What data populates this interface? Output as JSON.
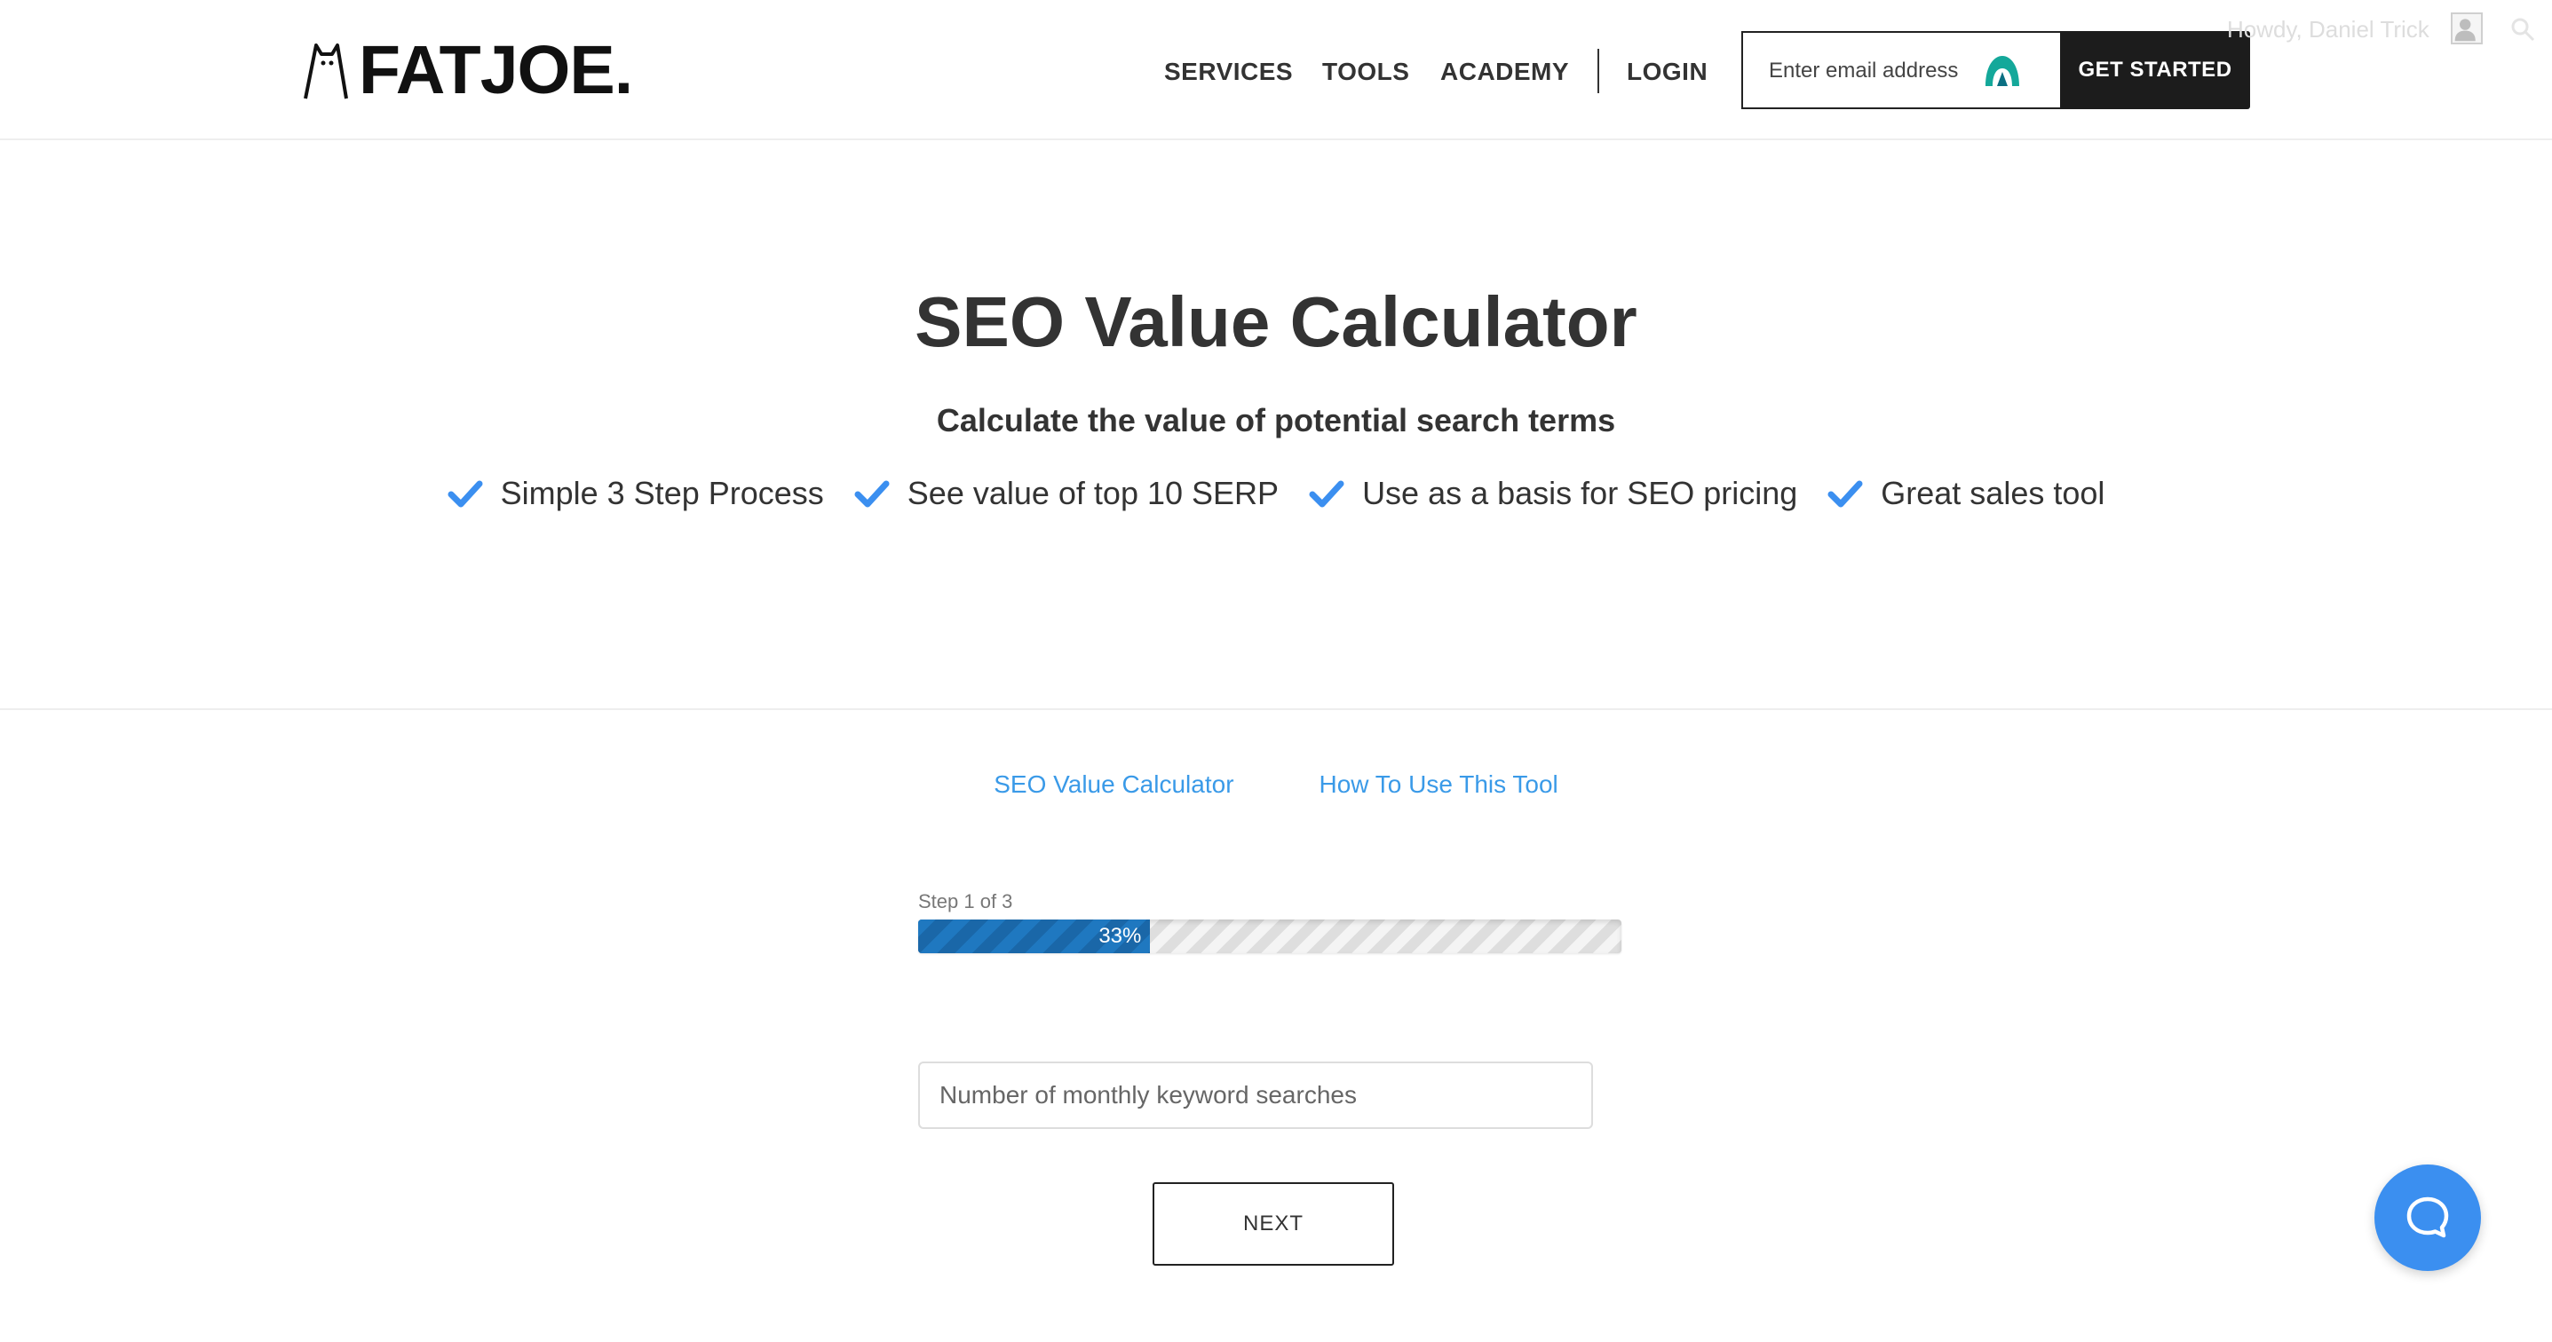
{
  "header": {
    "logo_text": "FATJOE.",
    "nav": [
      "SERVICES",
      "TOOLS",
      "ACADEMY"
    ],
    "login_label": "LOGIN",
    "email_placeholder": "Enter email address",
    "cta_label": "GET STARTED",
    "howdy_text": "Howdy, Daniel Trick"
  },
  "hero": {
    "title": "SEO Value Calculator",
    "subtitle": "Calculate the value of potential search terms",
    "features": [
      "Simple 3 Step Process",
      "See value of top 10 SERP",
      "Use as a basis for SEO pricing",
      "Great sales tool"
    ]
  },
  "tool": {
    "tabs": [
      "SEO Value Calculator",
      "How To Use This Tool"
    ],
    "step_label": "Step 1 of 3",
    "progress_percent": 33,
    "progress_label": "33%",
    "input_placeholder": "Number of monthly keyword searches",
    "next_label": "NEXT"
  },
  "colors": {
    "accent_blue": "#3a9ae8",
    "check_blue": "#3b8ff0",
    "progress_blue": "#1d6fb5",
    "dark": "#1c1c1c",
    "text": "#333333"
  },
  "icons": {
    "feature_check": "checkmark-icon",
    "extension": "extension-icon",
    "chat": "chat-icon",
    "search": "search-icon"
  }
}
